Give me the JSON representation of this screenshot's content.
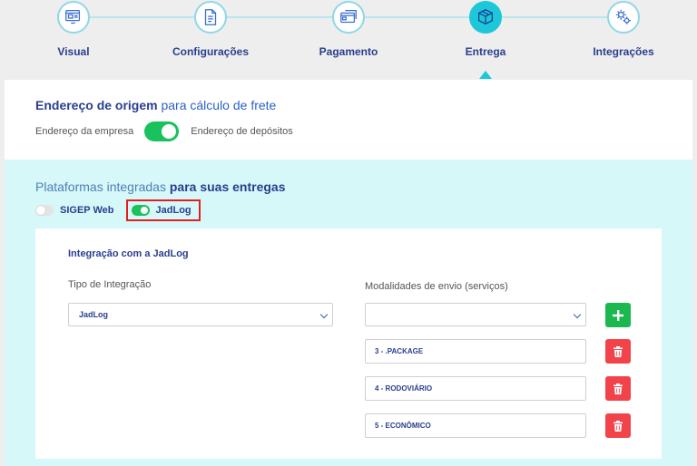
{
  "steps": [
    {
      "label": "Visual",
      "icon": "visual-icon"
    },
    {
      "label": "Configurações",
      "icon": "document-icon"
    },
    {
      "label": "Pagamento",
      "icon": "payment-icon"
    },
    {
      "label": "Entrega",
      "icon": "box-icon",
      "active": true
    },
    {
      "label": "Integrações",
      "icon": "integration-icon"
    }
  ],
  "origin": {
    "title_bold": "Endereço de origem",
    "title_rest": " para cálculo de frete",
    "left_option": "Endereço da empresa",
    "right_option": "Endereço de depósitos",
    "toggle_state": "on"
  },
  "platforms": {
    "title_light": "Plataformas integradas ",
    "title_bold": "para suas entregas",
    "items": [
      {
        "label": "SIGEP Web",
        "enabled": false
      },
      {
        "label": "JadLog",
        "enabled": true
      }
    ]
  },
  "integration": {
    "title": "Integração com a JadLog",
    "type_label": "Tipo de Integração",
    "type_value": "JadLog",
    "services_label": "Modalidades de envio (serviços)",
    "services_value": "",
    "services": [
      "3 - .PACKAGE",
      "4 - RODOVIÁRIO",
      "5 - ECONÔMICO"
    ]
  },
  "colors": {
    "accent": "#1cc7d9",
    "navy": "#2a3e8f",
    "toggle_on": "#19c25c",
    "add": "#1bb84f",
    "delete": "#f2434a",
    "highlight": "#e02020",
    "panel_bg": "#d7f8f9"
  }
}
